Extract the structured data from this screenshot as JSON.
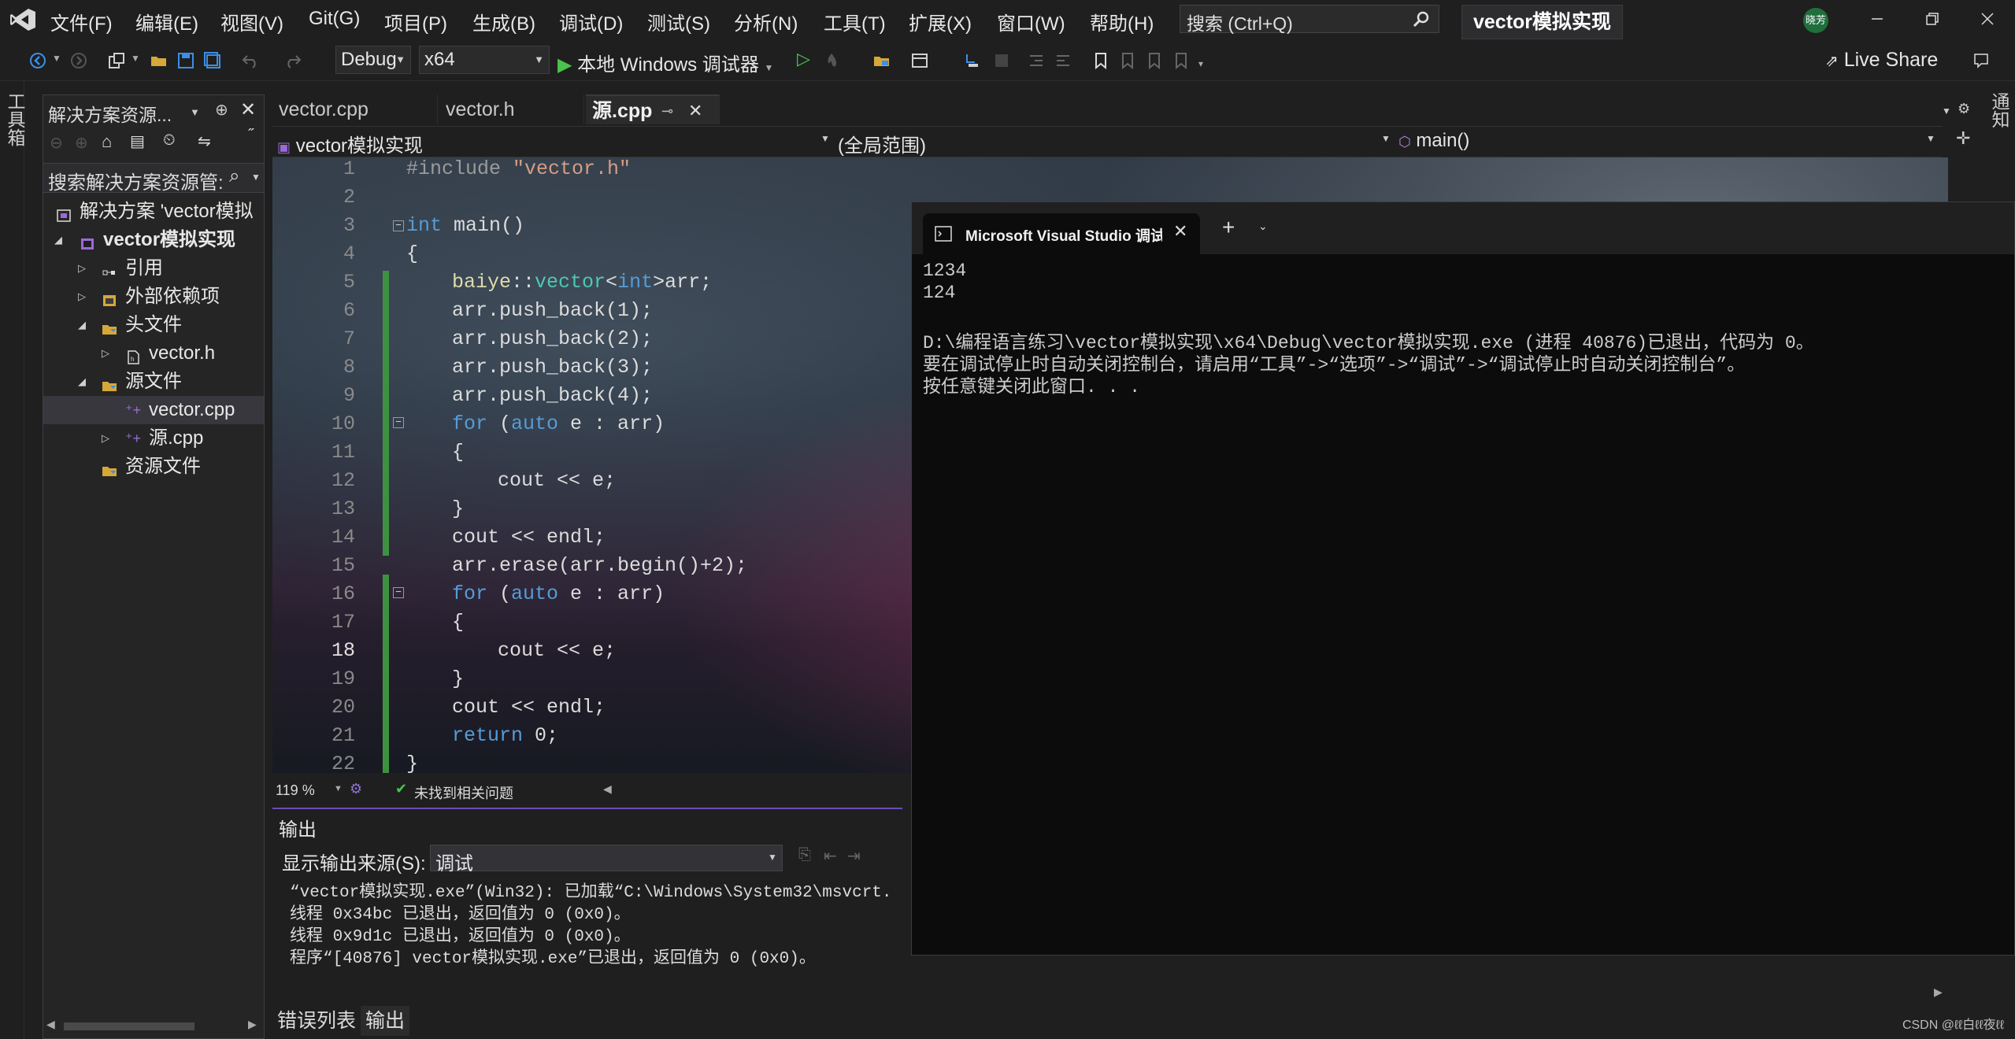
{
  "menu": [
    "文件(F)",
    "编辑(E)",
    "视图(V)",
    "Git(G)",
    "项目(P)",
    "生成(B)",
    "调试(D)",
    "测试(S)",
    "分析(N)",
    "工具(T)",
    "扩展(X)",
    "窗口(W)",
    "帮助(H)"
  ],
  "search": {
    "placeholder": "搜索 (Ctrl+Q)"
  },
  "solution_title": "vector模拟实现",
  "user_badge": "晓芳",
  "toolbar": {
    "config": "Debug",
    "platform": "x64",
    "run_label": "本地 Windows 调试器",
    "live_share": "Live Share"
  },
  "left_strip": {
    "toolbox": "工具箱"
  },
  "right_strip": {
    "notifications": "通知"
  },
  "solution_explorer": {
    "title": "解决方案资源...",
    "search_placeholder": "搜索解决方案资源管:",
    "items": [
      {
        "label": "解决方案 'vector模拟"
      },
      {
        "label": "vector模拟实现"
      },
      {
        "label": "引用"
      },
      {
        "label": "外部依赖项"
      },
      {
        "label": "头文件"
      },
      {
        "label": "vector.h"
      },
      {
        "label": "源文件"
      },
      {
        "label": "vector.cpp"
      },
      {
        "label": "源.cpp"
      },
      {
        "label": "资源文件"
      }
    ]
  },
  "editor": {
    "tabs": [
      "vector.cpp",
      "vector.h",
      "源.cpp"
    ],
    "nav": {
      "project": "vector模拟实现",
      "scope": "(全局范围)",
      "member": "main()"
    },
    "line_numbers": [
      "1",
      "2",
      "3",
      "4",
      "5",
      "6",
      "7",
      "8",
      "9",
      "10",
      "11",
      "12",
      "13",
      "14",
      "15",
      "16",
      "17",
      "18",
      "19",
      "20",
      "21",
      "22"
    ],
    "code": {
      "l1_pp": "#include",
      "l1_str": " \"vector.h\"",
      "l3_kw": "int",
      "l3_rest": " main()",
      "l4": "{",
      "l5_ns": "baiye",
      "l5_sep": "::",
      "l5_typ": "vector",
      "l5_lt": "<",
      "l5_kw": "int",
      "l5_rest": ">arr;",
      "l6": "arr.push_back(1);",
      "l7": "arr.push_back(2);",
      "l8": "arr.push_back(3);",
      "l9": "arr.push_back(4);",
      "l10_kw": "for",
      "l10_p": " (",
      "l10_auto": "auto",
      "l10_rest": " e : arr)",
      "l11": "{",
      "l12": "cout << e;",
      "l13": "}",
      "l14": "cout << endl;",
      "l15": "arr.erase(arr.begin()+2);",
      "l16_kw": "for",
      "l16_p": " (",
      "l16_auto": "auto",
      "l16_rest": " e : arr)",
      "l17": "{",
      "l18": "cout << e;",
      "l19": "}",
      "l20": "cout << endl;",
      "l21_kw": "return",
      "l21_rest": " 0;",
      "l22": "}"
    },
    "zoom": "119 %",
    "issues": "未找到相关问题"
  },
  "output": {
    "title": "输出",
    "source_label": "显示输出来源(S):",
    "source_value": "调试",
    "lines": [
      "“vector模拟实现.exe”(Win32): 已加载“C:\\Windows\\System32\\msvcrt.",
      "线程 0x34bc 已退出，返回值为 0 (0x0)。",
      "线程 0x9d1c 已退出，返回值为 0 (0x0)。",
      "程序“[40876] vector模拟实现.exe”已退出，返回值为 0 (0x0)。"
    ]
  },
  "bottom_tabs": [
    "错误列表",
    "输出"
  ],
  "console": {
    "tab_title": "Microsoft Visual Studio 调试控",
    "lines": [
      "1234",
      "124",
      "",
      "D:\\编程语言练习\\vector模拟实现\\x64\\Debug\\vector模拟实现.exe (进程 40876)已退出，代码为 0。",
      "要在调试停止时自动关闭控制台，请启用“工具”->“选项”->“调试”->“调试停止时自动关闭控制台”。",
      "按任意键关闭此窗口. . ."
    ]
  },
  "watermark": "CSDN @ℓℓ白ℓℓ夜ℓℓ"
}
